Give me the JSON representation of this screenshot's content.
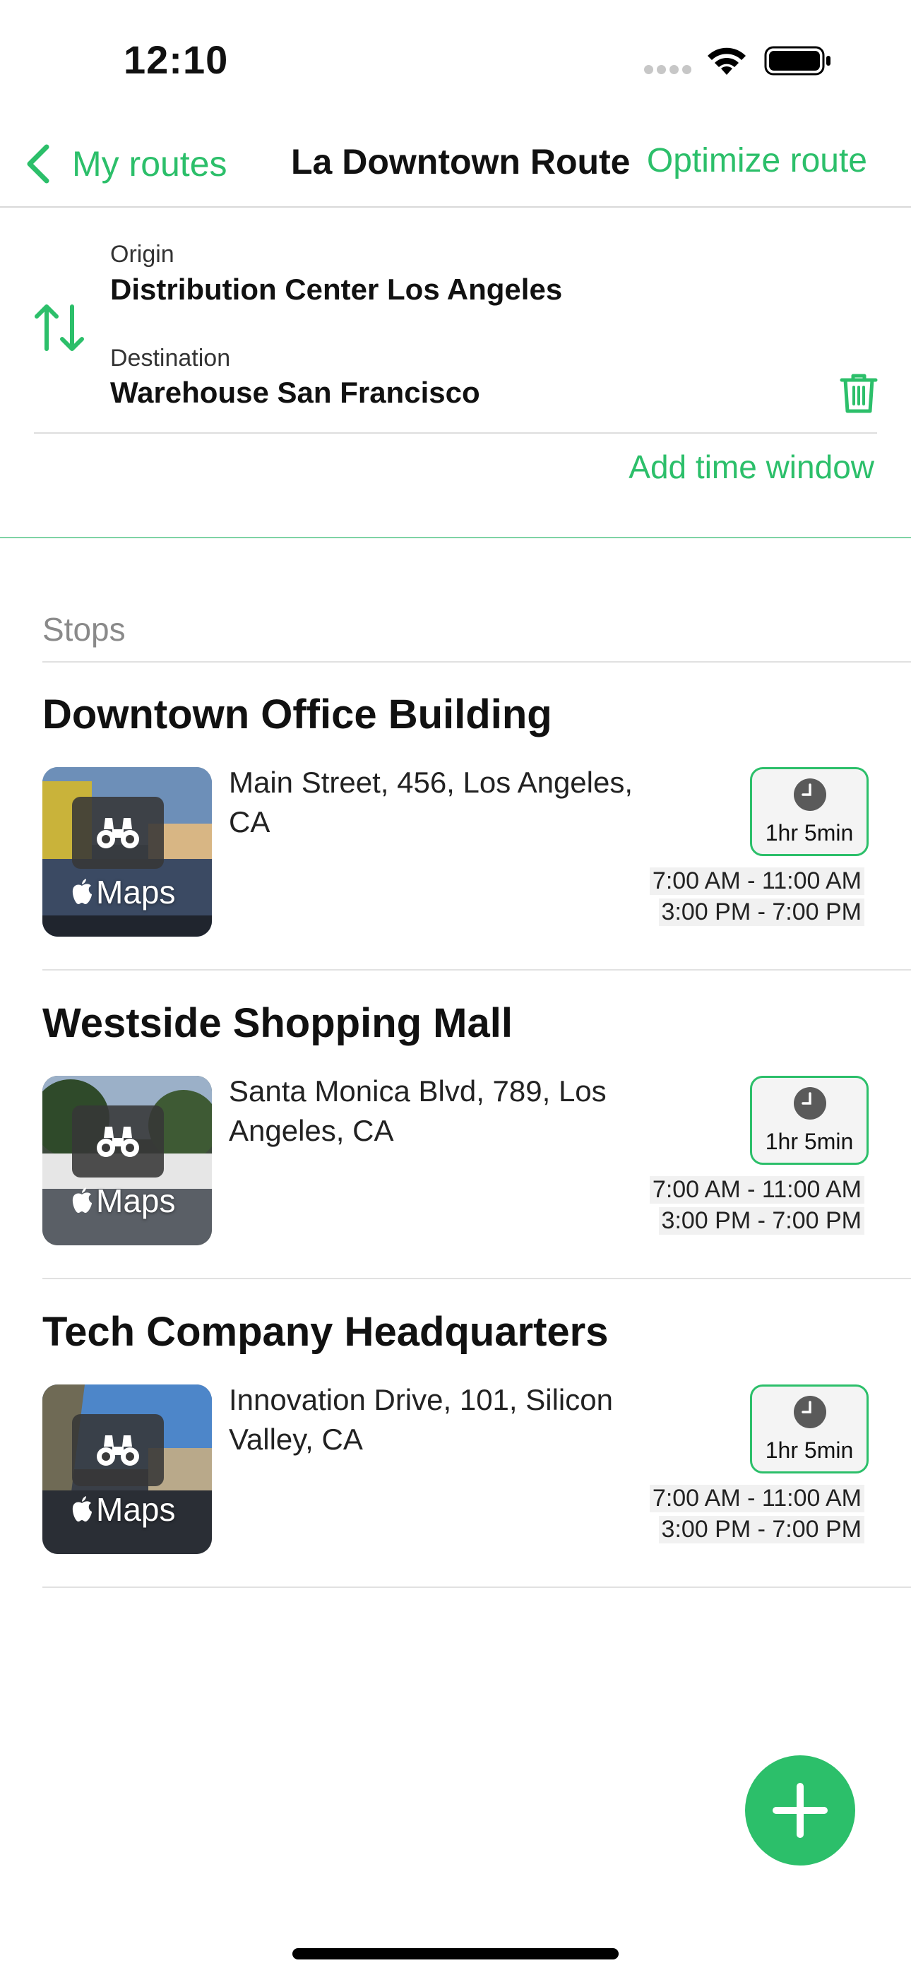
{
  "status_bar": {
    "time": "12:10"
  },
  "nav": {
    "back_label": "My routes",
    "title": "La Downtown Route",
    "action_label": "Optimize route"
  },
  "route": {
    "origin_label": "Origin",
    "origin_value": "Distribution Center Los Angeles",
    "destination_label": "Destination",
    "destination_value": "Warehouse San Francisco",
    "add_time_window_label": "Add time window"
  },
  "stops_header": "Stops",
  "stops": [
    {
      "name": "Downtown Office Building",
      "address": "Main Street, 456, Los Angeles, CA",
      "maps_label": "Maps",
      "duration": "1hr 5min",
      "time_windows": [
        "7:00 AM - 11:00 AM",
        "3:00 PM - 7:00 PM"
      ]
    },
    {
      "name": "Westside Shopping Mall",
      "address": "Santa Monica Blvd, 789, Los Angeles, CA",
      "maps_label": "Maps",
      "duration": "1hr 5min",
      "time_windows": [
        "7:00 AM - 11:00 AM",
        "3:00 PM - 7:00 PM"
      ]
    },
    {
      "name": "Tech Company Headquarters",
      "address": "Innovation Drive, 101, Silicon Valley, CA",
      "maps_label": "Maps",
      "duration": "1hr 5min",
      "time_windows": [
        "7:00 AM - 11:00 AM",
        "3:00 PM - 7:00 PM"
      ]
    }
  ],
  "colors": {
    "accent": "#2cbf6a",
    "divider": "#e1e1e1",
    "muted_text": "#8a8a8a"
  },
  "icons": {
    "back": "chevron-left-icon",
    "swap": "swap-vertical-icon",
    "delete": "trash-icon",
    "thumbnail": "binoculars-icon",
    "maps": "apple-logo-icon",
    "duration": "clock-icon",
    "add": "plus-icon"
  }
}
